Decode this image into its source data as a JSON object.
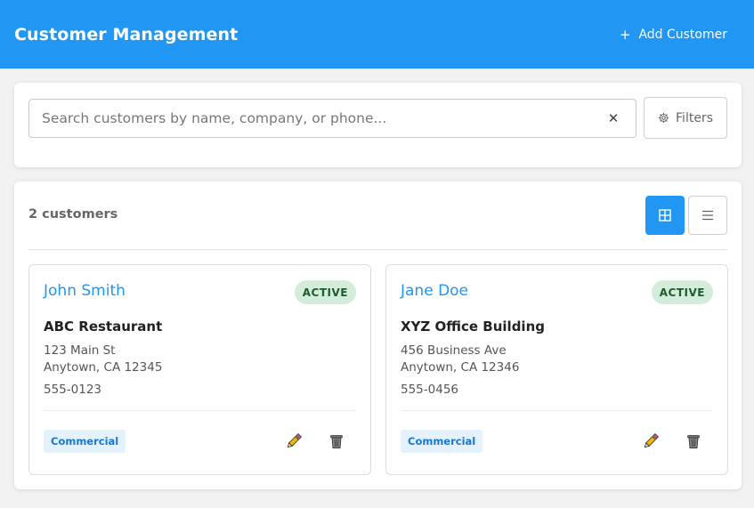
{
  "header": {
    "title": "Customer Management",
    "add_label": "Add Customer",
    "add_icon": "+",
    "bg_color": "#2196f3"
  },
  "search": {
    "placeholder": "Search customers by name, company, or phone...",
    "value": "",
    "clear_icon": "✕",
    "filters_label": "Filters"
  },
  "results": {
    "count_label": "2 customers",
    "view_mode": "grid"
  },
  "customers": [
    {
      "name": "John Smith",
      "status": "ACTIVE",
      "company": "ABC Restaurant",
      "address_line1": "123 Main St",
      "address_line2": "Anytown, CA 12345",
      "phone": "555-0123",
      "type": "Commercial"
    },
    {
      "name": "Jane Doe",
      "status": "ACTIVE",
      "company": "XYZ Office Building",
      "address_line1": "456 Business Ave",
      "address_line2": "Anytown, CA 12346",
      "phone": "555-0456",
      "type": "Commercial"
    }
  ]
}
